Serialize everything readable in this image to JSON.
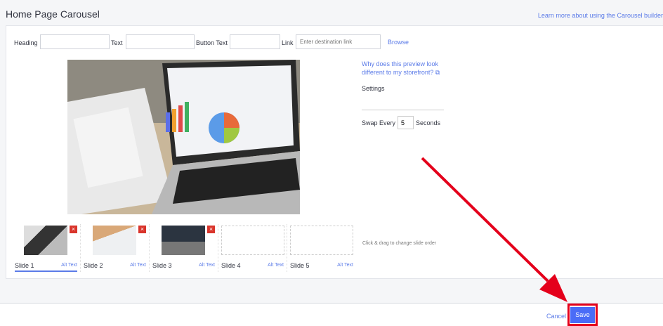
{
  "header": {
    "title": "Home Page Carousel",
    "learn_link": "Learn more about using the Carousel builder"
  },
  "form": {
    "heading_label": "Heading",
    "heading_value": "",
    "text_label": "Text",
    "text_value": "",
    "button_text_label": "Button Text",
    "button_text_value": "",
    "link_label": "Link",
    "link_placeholder": "Enter destination link",
    "browse": "Browse"
  },
  "side": {
    "why": "Why does this preview look different to my storefront?",
    "settings": "Settings",
    "swap_label": "Swap Every",
    "swap_value": "5",
    "seconds": "Seconds"
  },
  "slides": [
    {
      "name": "Slide 1",
      "alt": "Alt Text",
      "selected": true
    },
    {
      "name": "Slide 2",
      "alt": "Alt Text"
    },
    {
      "name": "Slide 3",
      "alt": "Alt Text"
    },
    {
      "name": "Slide 4",
      "alt": "Alt Text"
    },
    {
      "name": "Slide 5",
      "alt": "Alt Text"
    }
  ],
  "remove_icon": "×",
  "hint": "Click & drag to change slide order",
  "footer": {
    "cancel": "Cancel",
    "save": "Save"
  },
  "colors": {
    "accent": "#4a6cf7",
    "link": "#5b7be8",
    "highlight": "#e4001b",
    "remove": "#d9342b"
  }
}
